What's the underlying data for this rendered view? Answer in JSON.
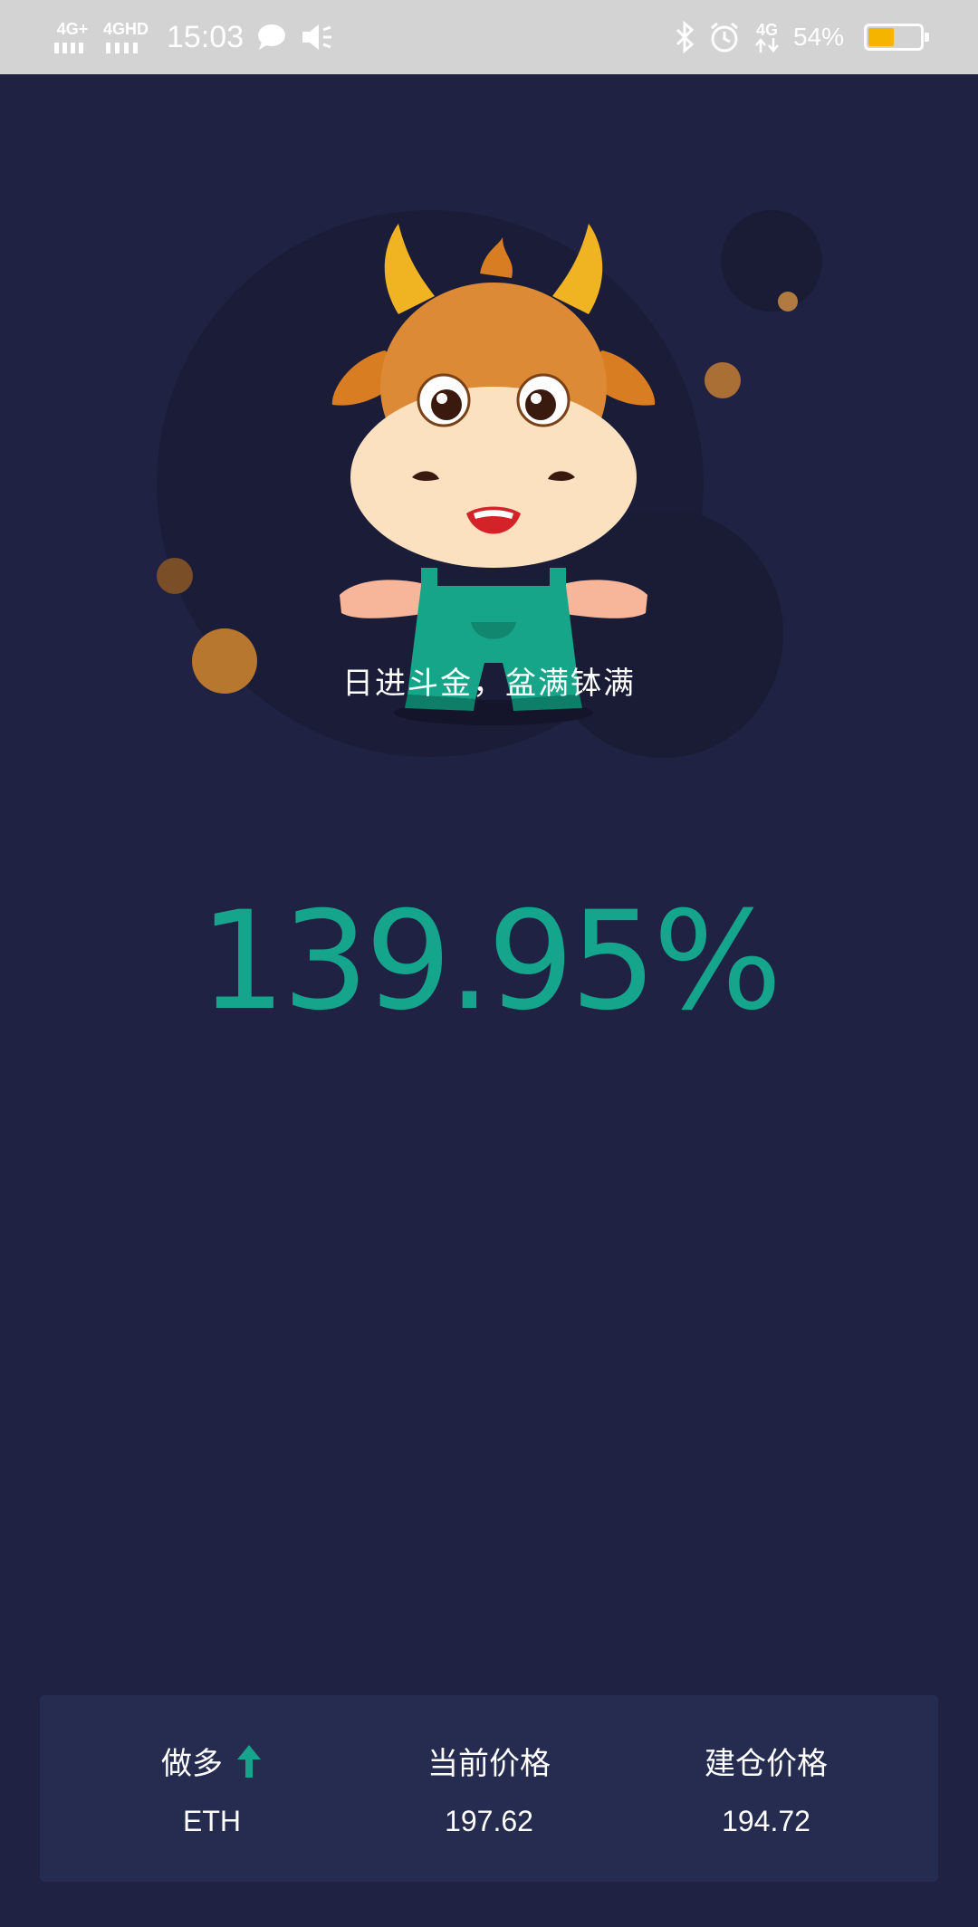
{
  "status_bar": {
    "net1": "4G+",
    "net2": "4GHD",
    "time": "15:03",
    "net3": "4G",
    "battery_pct": "54%",
    "battery_level": 0.54,
    "battery_color": "#f5b400"
  },
  "hero": {
    "slogan": "日进斗金，盆满钵满"
  },
  "profit_percent": "139.95%",
  "card": {
    "direction_label": "做多",
    "direction_symbol": "ETH",
    "current_price_label": "当前价格",
    "current_price": "197.62",
    "entry_price_label": "建仓价格",
    "entry_price": "194.72"
  },
  "colors": {
    "background": "#1f2242",
    "accent": "#15a48c",
    "card": "#252c4f"
  }
}
